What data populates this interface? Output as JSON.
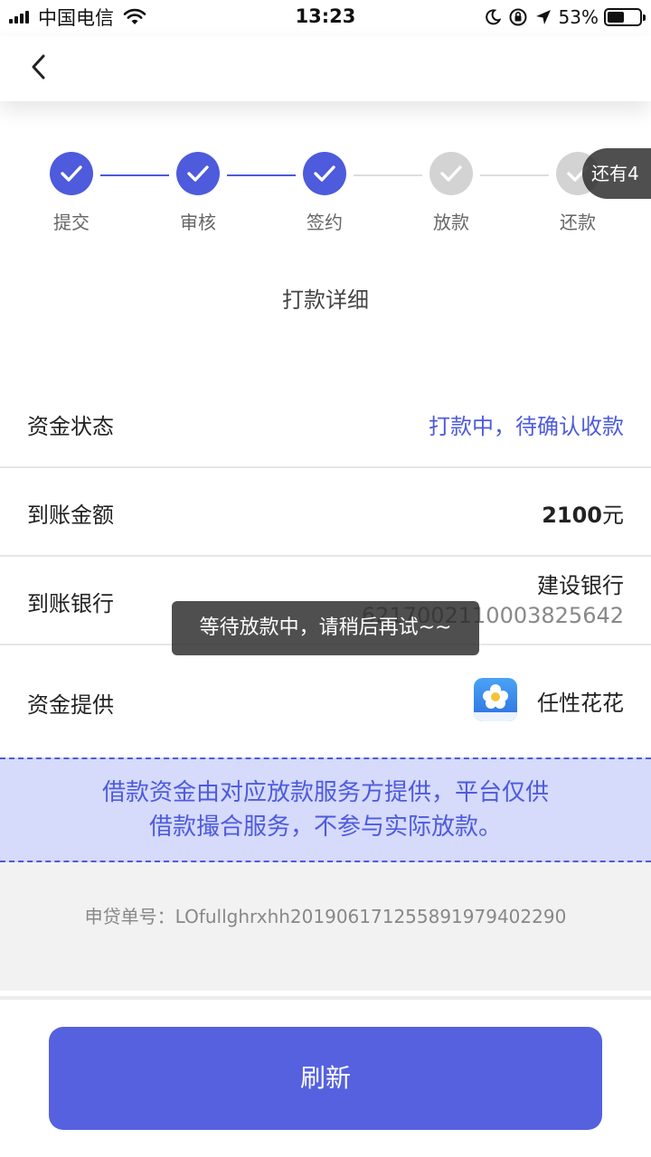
{
  "status_bar": {
    "carrier": "中国电信",
    "time": "13:23",
    "battery_percent": "53%",
    "battery_level": 0.53,
    "icons": [
      "signal-icon",
      "wifi-icon",
      "moon-icon",
      "rotation-lock-icon",
      "location-arrow-icon",
      "battery-icon"
    ]
  },
  "nav": {
    "back_icon": "chevron-left-icon"
  },
  "steps": [
    {
      "label": "提交",
      "status": "done"
    },
    {
      "label": "审核",
      "status": "done"
    },
    {
      "label": "签约",
      "status": "done"
    },
    {
      "label": "放款",
      "status": "todo"
    },
    {
      "label": "还款",
      "status": "todo"
    }
  ],
  "remain_badge": "还有4",
  "section_title": "打款详细",
  "details": {
    "fund_status": {
      "label": "资金状态",
      "value": "打款中，待确认收款"
    },
    "amount": {
      "label": "到账金额",
      "number": "2100",
      "unit": "元"
    },
    "bank": {
      "label": "到账银行",
      "name": "建设银行",
      "account": "6217002110003825642"
    },
    "provider": {
      "label": "资金提供",
      "name": "任性花花",
      "logo_icon": "renxing-huahua-logo-icon"
    }
  },
  "notice": {
    "line1": "借款资金由对应放款服务方提供，平台仅供",
    "line2": "借款撮合服务，不参与实际放款。"
  },
  "order_number": "申贷单号：LOfullghrxhh2019061712558919794022 90",
  "refresh_button": "刷新",
  "toast": "等待放款中，请稍后再试~~",
  "colors": {
    "accent": "#4d5bdc",
    "button": "#5561de",
    "notice_bg": "#d6dafb"
  }
}
